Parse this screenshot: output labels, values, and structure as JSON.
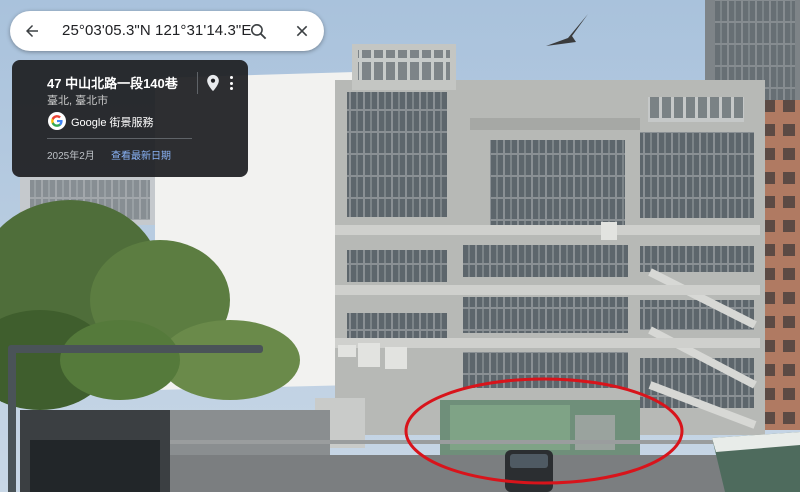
{
  "search": {
    "coordinates": "25°03'05.3\"N 121°31'14.3\"E",
    "back_icon": "arrow-left-icon",
    "search_icon": "search-icon",
    "close_icon": "close-icon"
  },
  "info_card": {
    "title": "47 中山北路一段140巷",
    "subtitle": "臺北, 臺北市",
    "service": "Google 街景服務",
    "date": "2025年2月",
    "latest_link": "查看最新日期",
    "pin_icon": "location-pin-icon",
    "more_icon": "more-vert-icon"
  },
  "colors": {
    "card_bg": "#202124",
    "link": "#8ab4f8",
    "annotation_circle": "#d8141b",
    "sky": "#9fb9d4"
  }
}
